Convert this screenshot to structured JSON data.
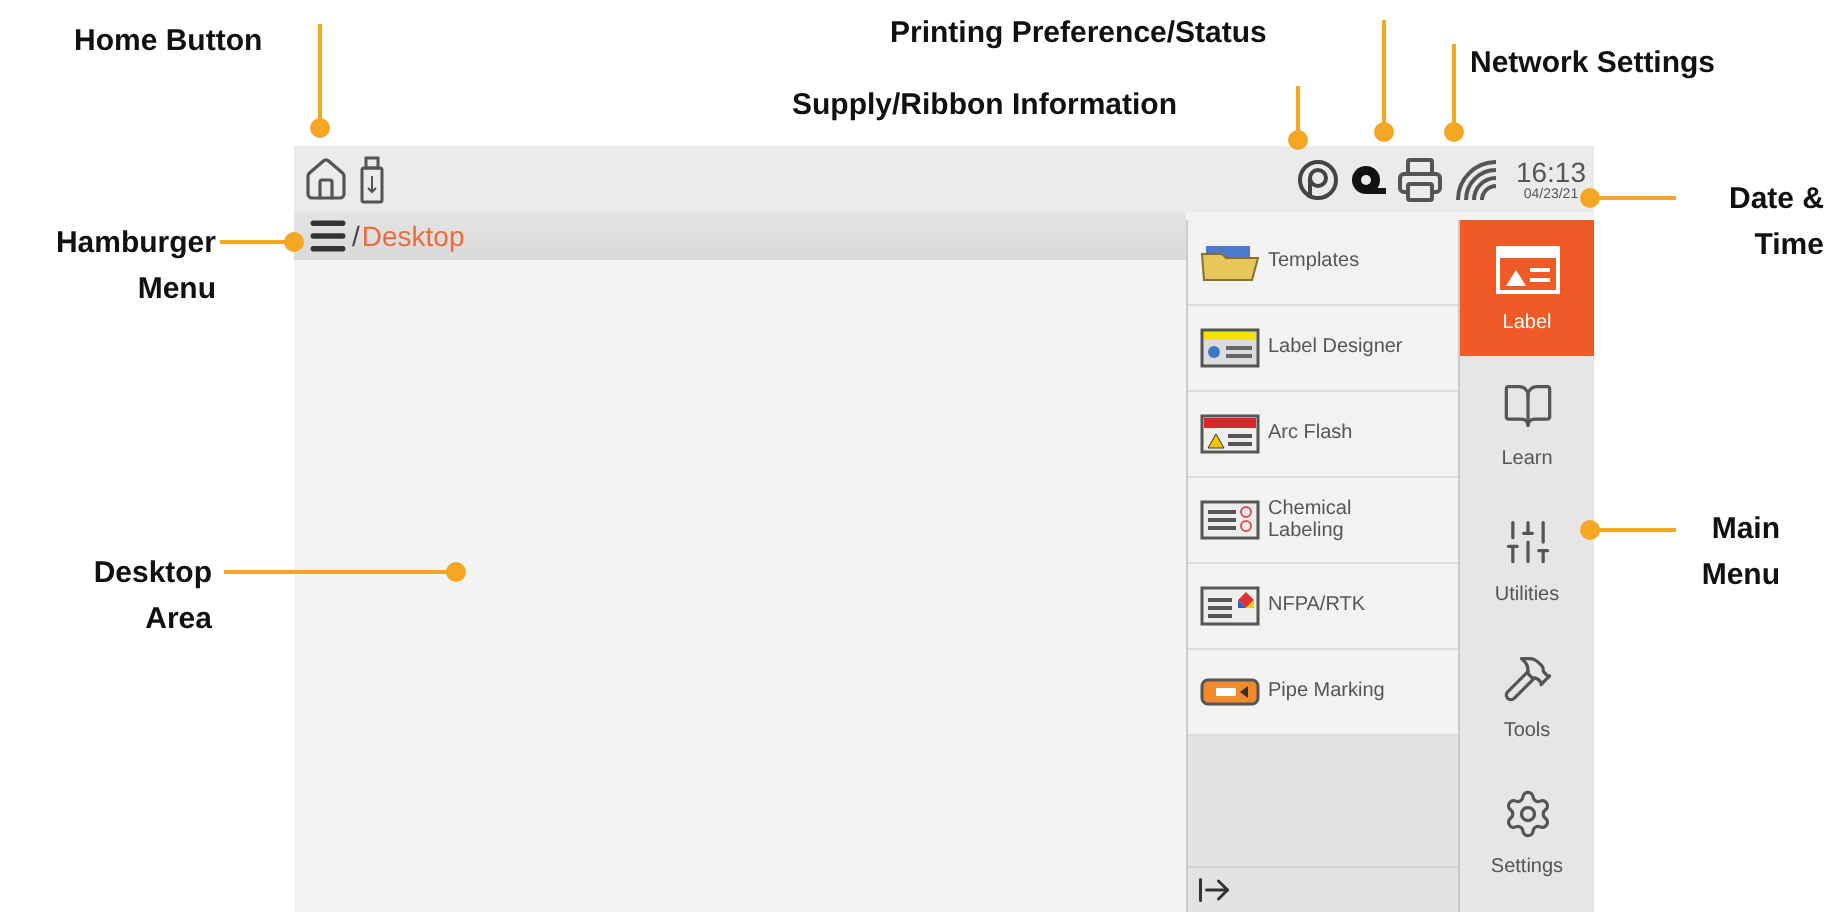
{
  "callouts": [
    {
      "text": "Home Button"
    },
    {
      "text": "Printing Preference/Status"
    },
    {
      "text": "Supply/Ribbon Information"
    },
    {
      "text": "Network Settings"
    },
    {
      "text": "Date & Time"
    },
    {
      "text": "Hamburger Menu"
    },
    {
      "text": "Desktop Area"
    },
    {
      "text": "Main Menu"
    }
  ],
  "status_bar": {
    "time": "16:13",
    "date": "04/23/21"
  },
  "breadcrumb": {
    "separator": "/",
    "current": "Desktop"
  },
  "label_menu": [
    {
      "label": "Templates"
    },
    {
      "label": "Label Designer"
    },
    {
      "label": "Arc Flash"
    },
    {
      "label": "Chemical Labeling"
    },
    {
      "label": "NFPA/RTK"
    },
    {
      "label": "Pipe Marking"
    }
  ],
  "main_menu": [
    {
      "label": "Label",
      "selected": true
    },
    {
      "label": "Learn",
      "selected": false
    },
    {
      "label": "Utilities",
      "selected": false
    },
    {
      "label": "Tools",
      "selected": false
    },
    {
      "label": "Settings",
      "selected": false
    }
  ]
}
